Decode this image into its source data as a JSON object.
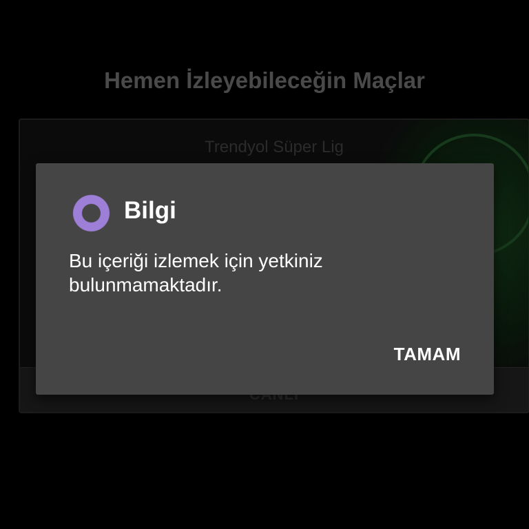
{
  "background_screen": {
    "title": "Hemen İzleyebileceğin Maçlar",
    "match_card": {
      "league": "Trendyol Süper Lig",
      "action_label": "CANLI"
    }
  },
  "dialog": {
    "icon": "purple-ring-icon",
    "title": "Bilgi",
    "message": "Bu içeriği izlemek için yetkiniz bulunmamaktadır.",
    "ok_button": "TAMAM"
  },
  "colors": {
    "background": "#000000",
    "dialog_bg": "#454545",
    "accent_purple": "#9d7fd8",
    "text_primary": "#ffffff"
  }
}
